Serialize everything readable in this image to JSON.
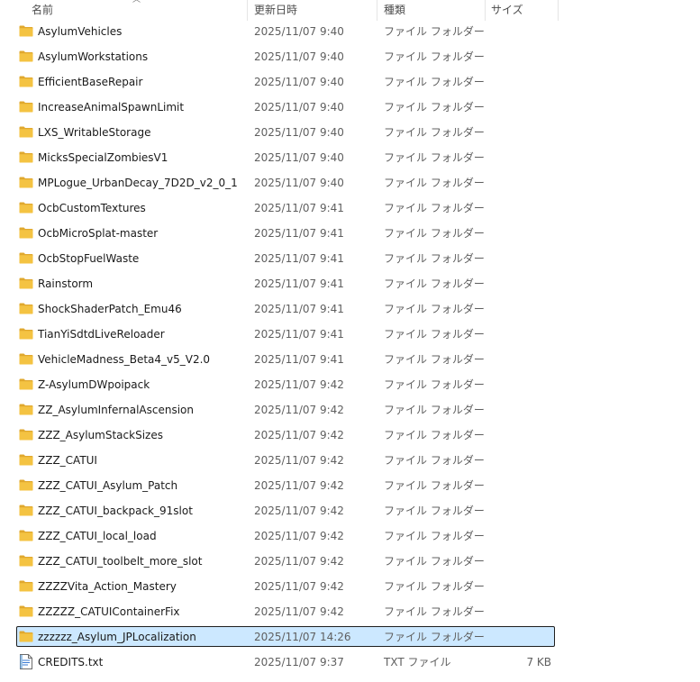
{
  "columns": {
    "name": "名前",
    "date": "更新日時",
    "type": "種類",
    "size": "サイズ"
  },
  "colors": {
    "selection_bg": "#cce8ff",
    "folder": "#f4c342",
    "folder_dark": "#e0a82e"
  },
  "rows": [
    {
      "name": "AsylumVehicles",
      "date": "2025/11/07 9:40",
      "type": "ファイル フォルダー",
      "size": "",
      "icon": "folder-icon"
    },
    {
      "name": "AsylumWorkstations",
      "date": "2025/11/07 9:40",
      "type": "ファイル フォルダー",
      "size": "",
      "icon": "folder-icon"
    },
    {
      "name": "EfficientBaseRepair",
      "date": "2025/11/07 9:40",
      "type": "ファイル フォルダー",
      "size": "",
      "icon": "folder-icon"
    },
    {
      "name": "IncreaseAnimalSpawnLimit",
      "date": "2025/11/07 9:40",
      "type": "ファイル フォルダー",
      "size": "",
      "icon": "folder-icon"
    },
    {
      "name": "LXS_WritableStorage",
      "date": "2025/11/07 9:40",
      "type": "ファイル フォルダー",
      "size": "",
      "icon": "folder-icon"
    },
    {
      "name": "MicksSpecialZombiesV1",
      "date": "2025/11/07 9:40",
      "type": "ファイル フォルダー",
      "size": "",
      "icon": "folder-icon"
    },
    {
      "name": "MPLogue_UrbanDecay_7D2D_v2_0_1",
      "date": "2025/11/07 9:40",
      "type": "ファイル フォルダー",
      "size": "",
      "icon": "folder-icon"
    },
    {
      "name": "OcbCustomTextures",
      "date": "2025/11/07 9:41",
      "type": "ファイル フォルダー",
      "size": "",
      "icon": "folder-icon"
    },
    {
      "name": "OcbMicroSplat-master",
      "date": "2025/11/07 9:41",
      "type": "ファイル フォルダー",
      "size": "",
      "icon": "folder-icon"
    },
    {
      "name": "OcbStopFuelWaste",
      "date": "2025/11/07 9:41",
      "type": "ファイル フォルダー",
      "size": "",
      "icon": "folder-icon"
    },
    {
      "name": "Rainstorm",
      "date": "2025/11/07 9:41",
      "type": "ファイル フォルダー",
      "size": "",
      "icon": "folder-icon"
    },
    {
      "name": "ShockShaderPatch_Emu46",
      "date": "2025/11/07 9:41",
      "type": "ファイル フォルダー",
      "size": "",
      "icon": "folder-icon"
    },
    {
      "name": "TianYiSdtdLiveReloader",
      "date": "2025/11/07 9:41",
      "type": "ファイル フォルダー",
      "size": "",
      "icon": "folder-icon"
    },
    {
      "name": "VehicleMadness_Beta4_v5_V2.0",
      "date": "2025/11/07 9:41",
      "type": "ファイル フォルダー",
      "size": "",
      "icon": "folder-icon"
    },
    {
      "name": "Z-AsylumDWpoipack",
      "date": "2025/11/07 9:42",
      "type": "ファイル フォルダー",
      "size": "",
      "icon": "folder-icon"
    },
    {
      "name": "ZZ_AsylumInfernalAscension",
      "date": "2025/11/07 9:42",
      "type": "ファイル フォルダー",
      "size": "",
      "icon": "folder-icon"
    },
    {
      "name": "ZZZ_AsylumStackSizes",
      "date": "2025/11/07 9:42",
      "type": "ファイル フォルダー",
      "size": "",
      "icon": "folder-icon"
    },
    {
      "name": "ZZZ_CATUI",
      "date": "2025/11/07 9:42",
      "type": "ファイル フォルダー",
      "size": "",
      "icon": "folder-icon"
    },
    {
      "name": "ZZZ_CATUI_Asylum_Patch",
      "date": "2025/11/07 9:42",
      "type": "ファイル フォルダー",
      "size": "",
      "icon": "folder-icon"
    },
    {
      "name": "ZZZ_CATUI_backpack_91slot",
      "date": "2025/11/07 9:42",
      "type": "ファイル フォルダー",
      "size": "",
      "icon": "folder-icon"
    },
    {
      "name": "ZZZ_CATUI_local_load",
      "date": "2025/11/07 9:42",
      "type": "ファイル フォルダー",
      "size": "",
      "icon": "folder-icon"
    },
    {
      "name": "ZZZ_CATUI_toolbelt_more_slot",
      "date": "2025/11/07 9:42",
      "type": "ファイル フォルダー",
      "size": "",
      "icon": "folder-icon"
    },
    {
      "name": "ZZZZVita_Action_Mastery",
      "date": "2025/11/07 9:42",
      "type": "ファイル フォルダー",
      "size": "",
      "icon": "folder-icon"
    },
    {
      "name": "ZZZZZ_CATUIContainerFix",
      "date": "2025/11/07 9:42",
      "type": "ファイル フォルダー",
      "size": "",
      "icon": "folder-icon"
    },
    {
      "name": "zzzzzz_Asylum_JPLocalization",
      "date": "2025/11/07 14:26",
      "type": "ファイル フォルダー",
      "size": "",
      "icon": "folder-icon",
      "selected": true
    },
    {
      "name": "CREDITS.txt",
      "date": "2025/11/07 9:37",
      "type": "TXT ファイル",
      "size": "7 KB",
      "icon": "text-file-icon"
    }
  ]
}
